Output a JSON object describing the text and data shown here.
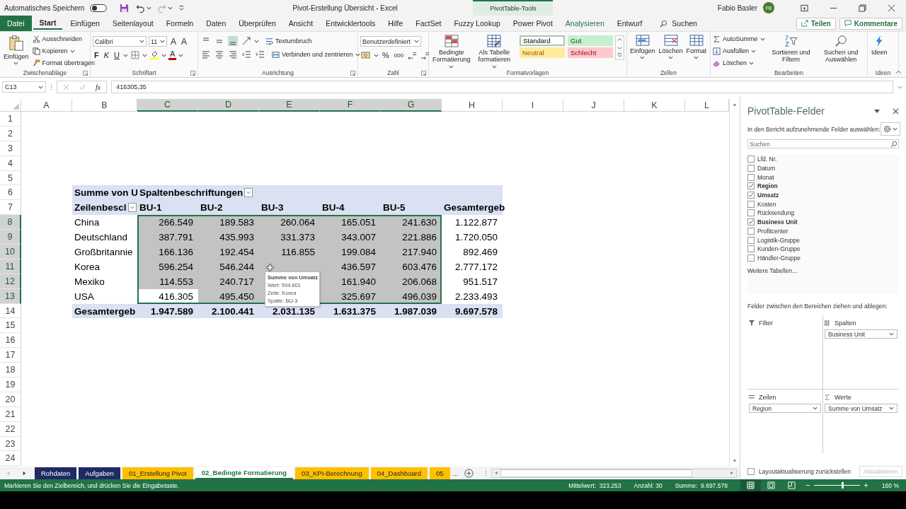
{
  "title_bar": {
    "autosave_label": "Automatisches Speichern",
    "autosave_on": false,
    "document_title": "Pivot-Erstellung Übersicht  -  Excel",
    "context_label": "PivotTable-Tools",
    "user_name": "Fabio Basler",
    "user_initials": "FB"
  },
  "ribbon_tabs": [
    {
      "label": "Datei",
      "kind": "file",
      "selected": false
    },
    {
      "label": "Start",
      "kind": "normal",
      "selected": true
    },
    {
      "label": "Einfügen",
      "kind": "normal",
      "selected": false
    },
    {
      "label": "Seitenlayout",
      "kind": "normal",
      "selected": false
    },
    {
      "label": "Formeln",
      "kind": "normal",
      "selected": false
    },
    {
      "label": "Daten",
      "kind": "normal",
      "selected": false
    },
    {
      "label": "Überprüfen",
      "kind": "normal",
      "selected": false
    },
    {
      "label": "Ansicht",
      "kind": "normal",
      "selected": false
    },
    {
      "label": "Entwicklertools",
      "kind": "normal",
      "selected": false
    },
    {
      "label": "Hilfe",
      "kind": "normal",
      "selected": false
    },
    {
      "label": "FactSet",
      "kind": "normal",
      "selected": false
    },
    {
      "label": "Fuzzy Lookup",
      "kind": "normal",
      "selected": false
    },
    {
      "label": "Power Pivot",
      "kind": "normal",
      "selected": false
    },
    {
      "label": "Analysieren",
      "kind": "contextual",
      "selected": false
    },
    {
      "label": "Entwurf",
      "kind": "normal",
      "selected": false
    }
  ],
  "tell_me": "Suchen",
  "share_button": "Teilen",
  "comments_button": "Kommentare",
  "ribbon": {
    "clipboard": {
      "label": "Zwischenablage",
      "paste": "Einfügen",
      "cut": "Ausschneiden",
      "copy": "Kopieren",
      "format_painter": "Format übertragen"
    },
    "font": {
      "label": "Schriftart",
      "family": "Calibri",
      "size": "11",
      "grow": "A",
      "shrink": "A",
      "bold": "F",
      "italic": "K",
      "underline": "U",
      "font_color": "A"
    },
    "alignment": {
      "label": "Ausrichtung",
      "wrap": "Textumbruch",
      "merge": "Verbinden und zentrieren",
      "vertical": [
        {
          "selected": false
        },
        {
          "selected": false
        },
        {
          "selected": true
        }
      ]
    },
    "number": {
      "label": "Zahl",
      "format": "Benutzerdefiniert",
      "percent": "%",
      "thousands": "000"
    },
    "styles": {
      "label": "Formatvorlagen",
      "conditional": "Bedingte Formatierung",
      "as_table": "Als Tabelle formatieren",
      "gallery": [
        {
          "label": "Standard",
          "kind": "normal",
          "selected": true
        },
        {
          "label": "Gut",
          "kind": "good",
          "selected": false
        },
        {
          "label": "Neutral",
          "kind": "neutral",
          "selected": false
        },
        {
          "label": "Schlecht",
          "kind": "bad",
          "selected": false
        }
      ]
    },
    "cells": {
      "label": "Zellen",
      "insert": "Einfügen",
      "delete": "Löschen",
      "format": "Format"
    },
    "editing": {
      "label": "Bearbeiten",
      "autosum": "AutoSumme",
      "fill": "Ausfüllen",
      "clear": "Löschen",
      "sort": "Sortieren und Filtern",
      "find": "Suchen und Auswählen"
    },
    "ideas": {
      "label": "Ideen",
      "button": "Ideen"
    }
  },
  "formula_bar": {
    "name_box": "C13",
    "fx": "fx",
    "value": "416305,35"
  },
  "sheet": {
    "columns": [
      {
        "letter": "A",
        "selected": false
      },
      {
        "letter": "B",
        "selected": false
      },
      {
        "letter": "C",
        "selected": true
      },
      {
        "letter": "D",
        "selected": true
      },
      {
        "letter": "E",
        "selected": true
      },
      {
        "letter": "F",
        "selected": true
      },
      {
        "letter": "G",
        "selected": true
      },
      {
        "letter": "H",
        "selected": false
      },
      {
        "letter": "I",
        "selected": false
      },
      {
        "letter": "J",
        "selected": false
      },
      {
        "letter": "K",
        "selected": false
      },
      {
        "letter": "L",
        "selected": false
      }
    ],
    "rows": [
      {
        "number": "1",
        "selected": false
      },
      {
        "number": "2",
        "selected": false
      },
      {
        "number": "3",
        "selected": false
      },
      {
        "number": "4",
        "selected": false
      },
      {
        "number": "5",
        "selected": false
      },
      {
        "number": "6",
        "selected": false
      },
      {
        "number": "7",
        "selected": false
      },
      {
        "number": "8",
        "selected": true
      },
      {
        "number": "9",
        "selected": true
      },
      {
        "number": "10",
        "selected": true
      },
      {
        "number": "11",
        "selected": true
      },
      {
        "number": "12",
        "selected": true
      },
      {
        "number": "13",
        "selected": true
      },
      {
        "number": "14",
        "selected": false
      },
      {
        "number": "15",
        "selected": false
      },
      {
        "number": "16",
        "selected": false
      },
      {
        "number": "17",
        "selected": false
      },
      {
        "number": "18",
        "selected": false
      },
      {
        "number": "19",
        "selected": false
      },
      {
        "number": "20",
        "selected": false
      },
      {
        "number": "21",
        "selected": false
      },
      {
        "number": "22",
        "selected": false
      },
      {
        "number": "23",
        "selected": false
      },
      {
        "number": "24",
        "selected": false
      }
    ]
  },
  "pivot": {
    "corner": "Summe von U",
    "column_field": "Spaltenbeschriftungen",
    "row_field": "Zeilenbescl",
    "column_headers": [
      "BU-1",
      "BU-2",
      "BU-3",
      "BU-4",
      "BU-5"
    ],
    "total_header": "Gesamtergeb",
    "rows": [
      {
        "label": "China",
        "cells": [
          {
            "text": "266.549",
            "active": false
          },
          {
            "text": "189.583",
            "active": false
          },
          {
            "text": "260.064",
            "active": false
          },
          {
            "text": "165.051",
            "active": false
          },
          {
            "text": "241.630",
            "active": false
          }
        ],
        "total": "1.122.877"
      },
      {
        "label": "Deutschland",
        "cells": [
          {
            "text": "387.791",
            "active": false
          },
          {
            "text": "435.993",
            "active": false
          },
          {
            "text": "331.373",
            "active": false
          },
          {
            "text": "343.007",
            "active": false
          },
          {
            "text": "221.886",
            "active": false
          }
        ],
        "total": "1.720.050"
      },
      {
        "label": "Großbritannie",
        "cells": [
          {
            "text": "166.136",
            "active": false
          },
          {
            "text": "192.454",
            "active": false
          },
          {
            "text": "116.855",
            "active": false
          },
          {
            "text": "199.084",
            "active": false
          },
          {
            "text": "217.940",
            "active": false
          }
        ],
        "total": "892.469"
      },
      {
        "label": "Korea",
        "cells": [
          {
            "text": "596.254",
            "active": false
          },
          {
            "text": "546.244",
            "active": false
          },
          {
            "text": null,
            "active": false
          },
          {
            "text": "436.597",
            "active": false
          },
          {
            "text": "603.476",
            "active": false
          }
        ],
        "total": "2.777.172"
      },
      {
        "label": "Mexiko",
        "cells": [
          {
            "text": "114.553",
            "active": false
          },
          {
            "text": "240.717",
            "active": false
          },
          {
            "text": null,
            "active": false
          },
          {
            "text": "161.940",
            "active": false
          },
          {
            "text": "206.068",
            "active": false
          }
        ],
        "total": "951.517"
      },
      {
        "label": "USA",
        "cells": [
          {
            "text": "416.305",
            "active": true
          },
          {
            "text": "495.450",
            "active": false
          },
          {
            "text": null,
            "active": false
          },
          {
            "text": "325.697",
            "active": false
          },
          {
            "text": "496.039",
            "active": false
          }
        ],
        "total": "2.233.493"
      }
    ],
    "grand_total": {
      "label": "Gesamtergeb",
      "values": [
        "1.947.589",
        "2.100.441",
        "2.031.135",
        "1.631.375",
        "1.987.039"
      ],
      "total": "9.697.578"
    }
  },
  "tooltip": {
    "title": "Summe von Umsatz",
    "lines": [
      "Wert:  594.601",
      "Zeile: Korea",
      "Spalte: BU-3"
    ]
  },
  "sheet_tabs": [
    {
      "label": "Rohdaten",
      "color": "#1f2a63",
      "selected": false
    },
    {
      "label": "Aufgaben",
      "color": "#1f2a63",
      "selected": false
    },
    {
      "label": "01_Erstellung Pivot",
      "color": "#ffc000",
      "selected": false
    },
    {
      "label": "02_Bedingte Formatierung",
      "selected": true
    },
    {
      "label": "03_KPI-Berechnung",
      "color": "#ffc000",
      "selected": false
    },
    {
      "label": "04_Dashboard",
      "color": "#ffc000",
      "selected": false
    },
    {
      "label": "05",
      "color": "#ffc000",
      "selected": false
    }
  ],
  "more_tabs": "...",
  "field_list": {
    "title": "PivotTable-Felder",
    "prompt": "In den Bericht aufzunehmende Felder auswählen:",
    "search_placeholder": "Suchen",
    "fields": [
      {
        "label": "Lfd. Nr.",
        "checked": false
      },
      {
        "label": "Datum",
        "checked": false
      },
      {
        "label": "Monat",
        "checked": false
      },
      {
        "label": "Region",
        "checked": true
      },
      {
        "label": "Umsatz",
        "checked": true
      },
      {
        "label": "Kosten",
        "checked": false
      },
      {
        "label": "Rücksendung",
        "checked": false
      },
      {
        "label": "Business Unit",
        "checked": true
      },
      {
        "label": "Profitcenter",
        "checked": false
      },
      {
        "label": "Logistik-Gruppe",
        "checked": false
      },
      {
        "label": "Kunden-Gruppe",
        "checked": false
      },
      {
        "label": "Händler-Gruppe",
        "checked": false
      }
    ],
    "more_tables": "Weitere Tabellen...",
    "areas_prompt": "Felder zwischen den Bereichen ziehen und ablegen:",
    "areas": [
      {
        "title": "Filter",
        "kind": "filter"
      },
      {
        "title": "Spalten",
        "kind": "columns",
        "items": [
          "Business Unit"
        ]
      },
      {
        "title": "Zeilen",
        "kind": "rows",
        "items": [
          "Region"
        ]
      },
      {
        "title": "Werte",
        "kind": "values",
        "items": [
          "Summe von Umsatz"
        ]
      }
    ],
    "defer_label": "Layoutaktualisierung zurückstellen",
    "defer_checked": false,
    "update_button": "Aktualisieren",
    "update_disabled": true
  },
  "status_bar": {
    "message": "Markieren Sie den Zielbereich, und drücken Sie die Eingabetaste.",
    "stats": [
      "Mittelwert:  323.253",
      "Anzahl: 30",
      "Summe:  9.697.578"
    ],
    "views": [
      {
        "selected": true
      },
      {
        "selected": false
      },
      {
        "selected": false
      }
    ],
    "zoom": {
      "level": 0.6,
      "reading": "160 %"
    }
  }
}
